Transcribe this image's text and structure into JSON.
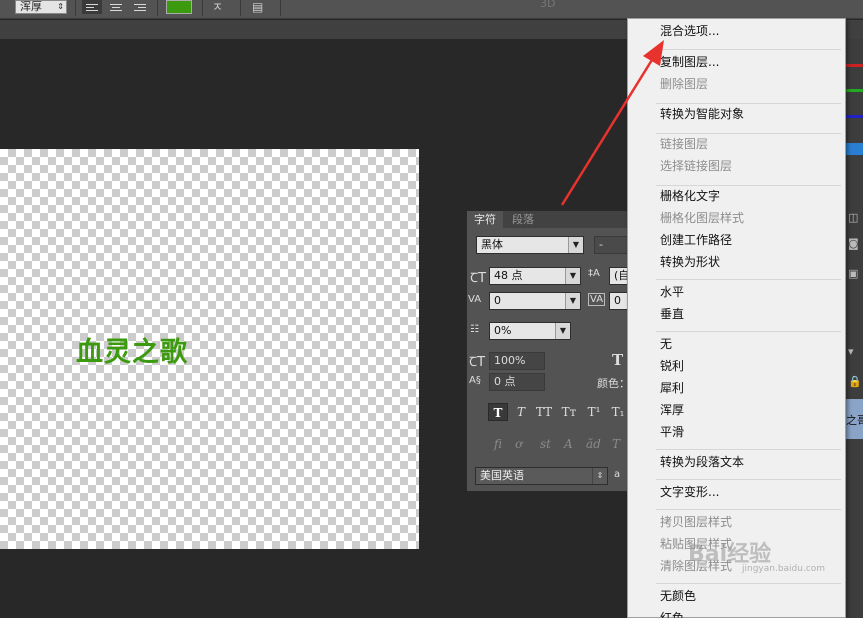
{
  "options_bar": {
    "antialias_value": "浑厚",
    "label_3d": "3D",
    "text_color": "#3c9a0e"
  },
  "canvas": {
    "text": "血灵之歌",
    "text_color": "#3c9a0e"
  },
  "character_panel": {
    "tabs": [
      "字符",
      "段落"
    ],
    "font_family": "黑体",
    "font_style": "-",
    "size": "48 点",
    "leading": "(自",
    "kerning": "0",
    "tracking": "0",
    "scale_percent": "0%",
    "vertical_scale": "100%",
    "baseline_shift": "0 点",
    "color_label": "颜色：",
    "language": "美国英语",
    "aa_prefix": "a",
    "style_buttons": [
      "T",
      "T",
      "TT",
      "Tт",
      "T¹",
      "T₁"
    ],
    "opentype_buttons": [
      "fi",
      "ơ",
      "st",
      "A",
      "ãd",
      "T"
    ]
  },
  "context_menu": {
    "items": [
      {
        "label": "混合选项...",
        "enabled": true
      },
      {
        "label": "复制图层...",
        "enabled": true
      },
      {
        "label": "删除图层",
        "enabled": false
      },
      {
        "label": "转换为智能对象",
        "enabled": true
      },
      {
        "label": "链接图层",
        "enabled": false
      },
      {
        "label": "选择链接图层",
        "enabled": false
      },
      {
        "label": "栅格化文字",
        "enabled": true
      },
      {
        "label": "栅格化图层样式",
        "enabled": false
      },
      {
        "label": "创建工作路径",
        "enabled": true
      },
      {
        "label": "转换为形状",
        "enabled": true
      },
      {
        "label": "水平",
        "enabled": true
      },
      {
        "label": "垂直",
        "enabled": true
      },
      {
        "label": "无",
        "enabled": true
      },
      {
        "label": "锐利",
        "enabled": true
      },
      {
        "label": "犀利",
        "enabled": true
      },
      {
        "label": "浑厚",
        "enabled": true
      },
      {
        "label": "平滑",
        "enabled": true
      },
      {
        "label": "转换为段落文本",
        "enabled": true
      },
      {
        "label": "文字变形...",
        "enabled": true
      },
      {
        "label": "拷贝图层样式",
        "enabled": false
      },
      {
        "label": "粘贴图层样式",
        "enabled": false
      },
      {
        "label": "清除图层样式",
        "enabled": false
      },
      {
        "label": "无颜色",
        "enabled": true
      },
      {
        "label": "红色",
        "enabled": true
      }
    ]
  },
  "right_strip": {
    "partial_label": "之哥"
  },
  "annotation": {
    "arrow_color": "#e8322d"
  },
  "watermark": {
    "text": "Bai经验",
    "url": "jingyan.baidu.com"
  }
}
